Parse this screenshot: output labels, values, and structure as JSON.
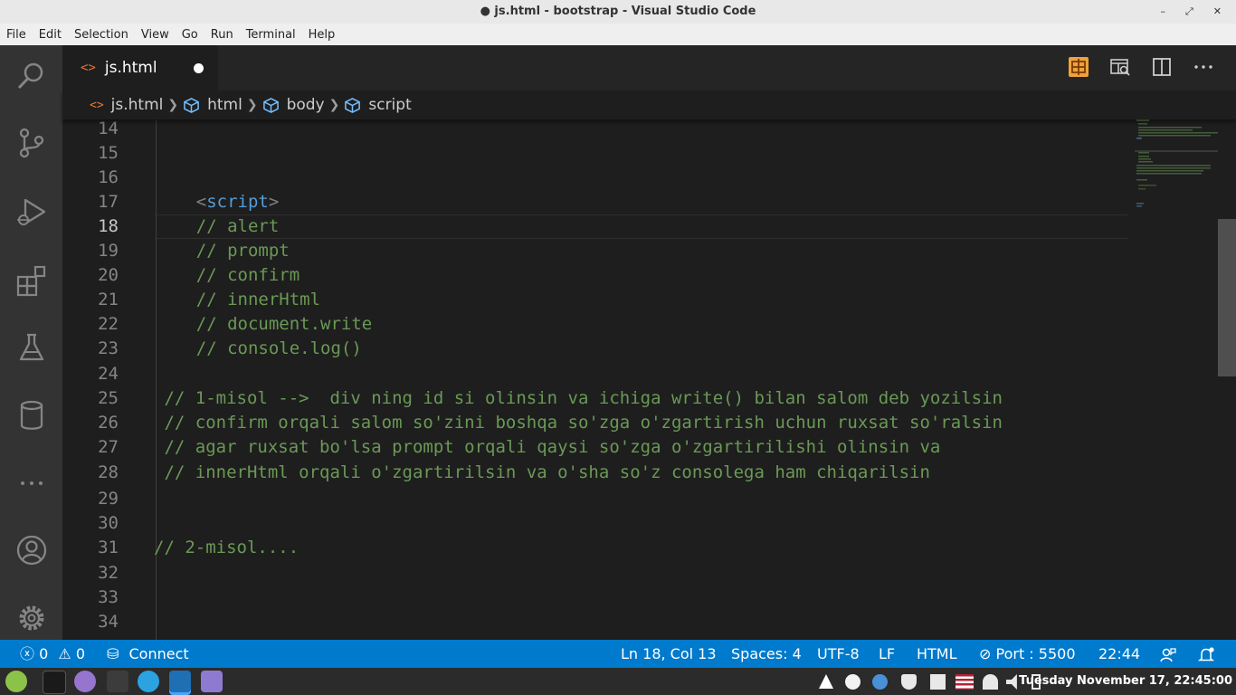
{
  "window": {
    "title": "● js.html - bootstrap - Visual Studio Code",
    "controls": [
      "–",
      "⤢",
      "✕"
    ]
  },
  "menu": [
    "File",
    "Edit",
    "Selection",
    "View",
    "Go",
    "Run",
    "Terminal",
    "Help"
  ],
  "tab": {
    "icon_text": "<>",
    "label": "js.html"
  },
  "breadcrumb": {
    "file_icon_text": "<>",
    "items": [
      "js.html",
      "html",
      "body",
      "script"
    ]
  },
  "editor": {
    "lines": [
      {
        "num": "14",
        "text": ""
      },
      {
        "num": "15",
        "text": ""
      },
      {
        "num": "16",
        "text": ""
      },
      {
        "num": "17",
        "indent": "    ",
        "tag_open": "<",
        "tag_name": "script",
        "tag_close": ">"
      },
      {
        "num": "18",
        "text": "    // alert"
      },
      {
        "num": "19",
        "text": "    // prompt"
      },
      {
        "num": "20",
        "text": "    // confirm"
      },
      {
        "num": "21",
        "text": "    // innerHtml"
      },
      {
        "num": "22",
        "text": "    // document.write"
      },
      {
        "num": "23",
        "text": "    // console.log()"
      },
      {
        "num": "24",
        "text": ""
      },
      {
        "num": "25",
        "text": " // 1-misol -->  div ning id si olinsin va ichiga write() bilan salom deb yozilsin"
      },
      {
        "num": "26",
        "text": " // confirm orqali salom so'zini boshqa so'zga o'zgartirish uchun ruxsat so'ralsin"
      },
      {
        "num": "27",
        "text": " // agar ruxsat bo'lsa prompt orqali qaysi so'zga o'zgartirilishi olinsin va"
      },
      {
        "num": "28",
        "text": " // innerHtml orqali o'zgartirilsin va o'sha so'z consolega ham chiqarilsin"
      },
      {
        "num": "29",
        "text": ""
      },
      {
        "num": "30",
        "text": ""
      },
      {
        "num": "31",
        "text": "// 2-misol...."
      },
      {
        "num": "32",
        "text": ""
      },
      {
        "num": "33",
        "text": ""
      },
      {
        "num": "34",
        "text": ""
      }
    ]
  },
  "status": {
    "errors": "0",
    "warnings": "0",
    "connect": "Connect",
    "position": "Ln 18, Col 13",
    "spaces": "Spaces: 4",
    "encoding": "UTF-8",
    "eol": "LF",
    "language": "HTML",
    "port": "Port : 5500",
    "time": "22:44"
  },
  "taskbar": {
    "clock": "Tuesday November 17, 22:45:00"
  },
  "colors": {
    "statusbar": "#007acc",
    "comment": "#6a9955",
    "tag": "#569cd6",
    "html_icon": "#e37933",
    "preview_icon": "#f0a13c"
  }
}
